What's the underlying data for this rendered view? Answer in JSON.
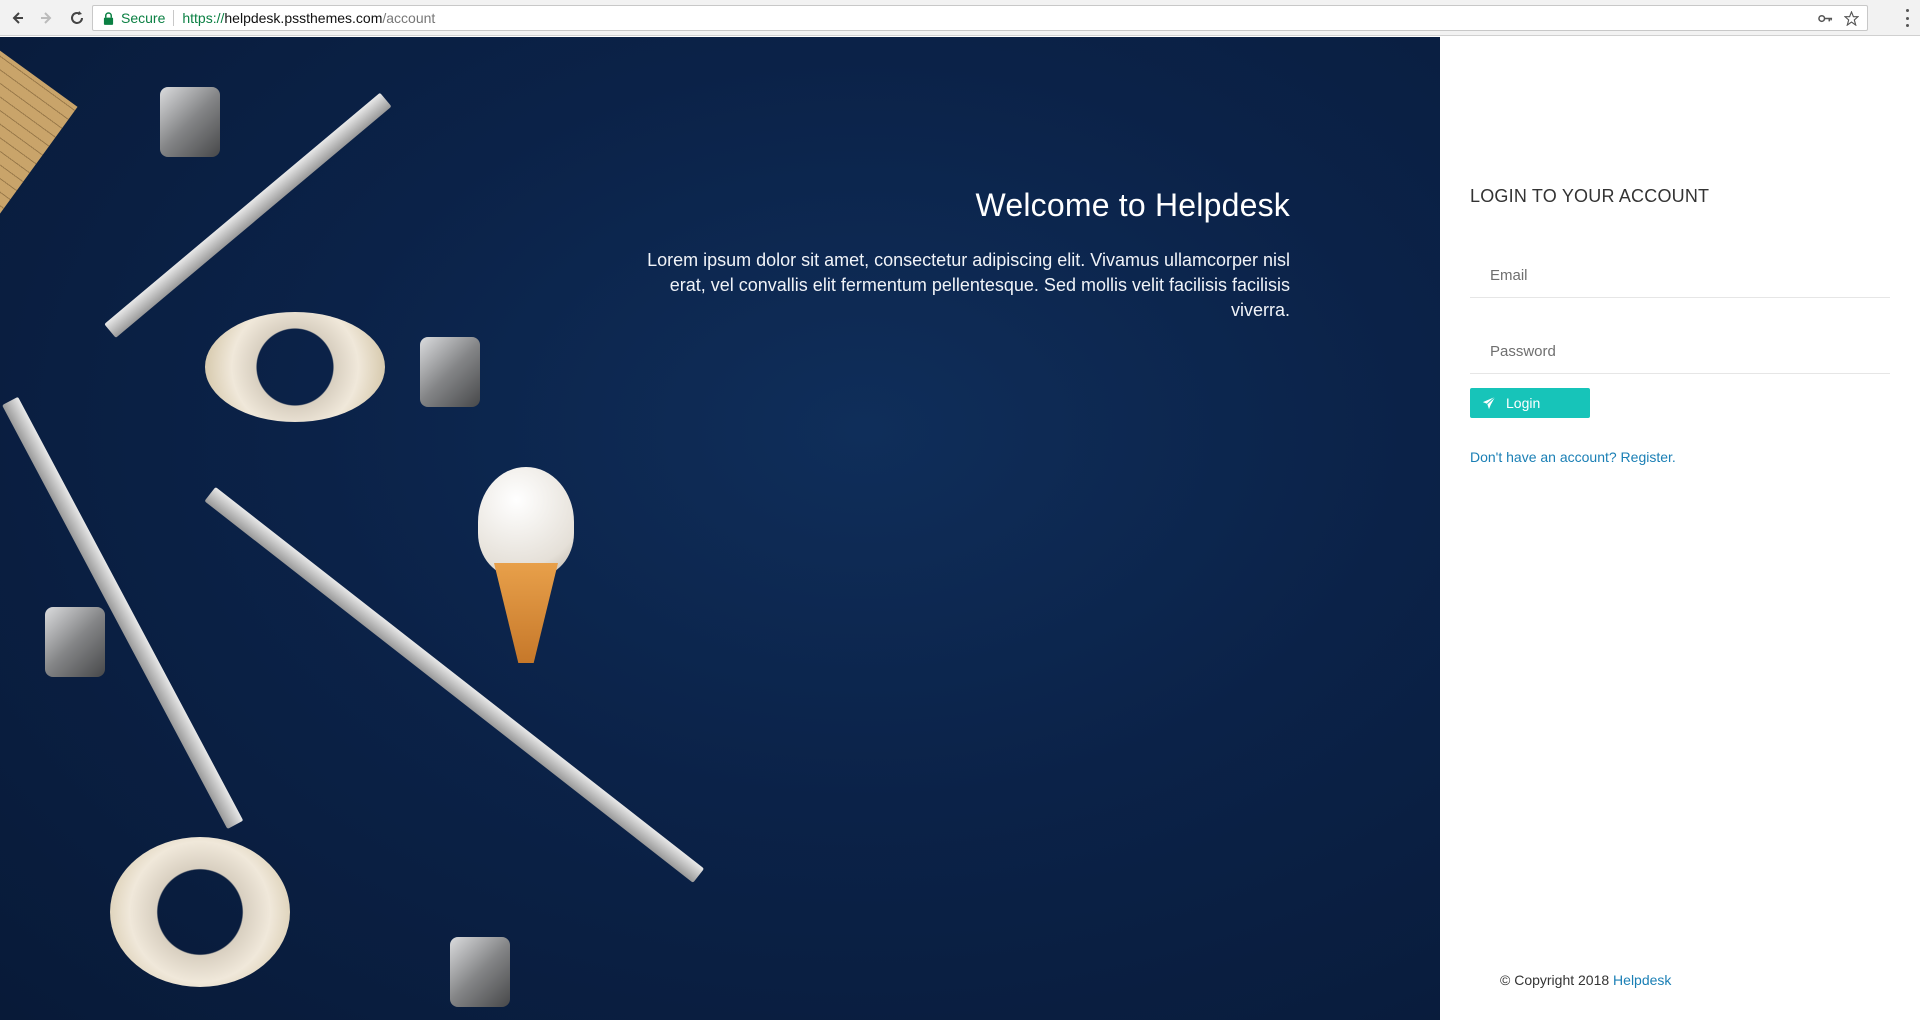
{
  "browser": {
    "secure_label": "Secure",
    "url_scheme": "https://",
    "url_host": "helpdesk.pssthemes.com",
    "url_path": "/account"
  },
  "hero": {
    "title": "Welcome to Helpdesk",
    "body": "Lorem ipsum dolor sit amet, consectetur adipiscing elit. Vivamus ullamcorper nisl erat, vel convallis elit fermentum pellentesque. Sed mollis velit facilisis facilisis viverra."
  },
  "login": {
    "title": "LOGIN TO YOUR ACCOUNT",
    "email_placeholder": "Email",
    "password_placeholder": "Password",
    "button_label": "Login",
    "register_text": "Don't have an account? Register."
  },
  "footer": {
    "copyright_prefix": "© Copyright 2018 ",
    "copyright_link": "Helpdesk"
  },
  "colors": {
    "accent": "#17c4b9",
    "link": "#1a7fb5",
    "hero_bg": "#0b2248"
  }
}
